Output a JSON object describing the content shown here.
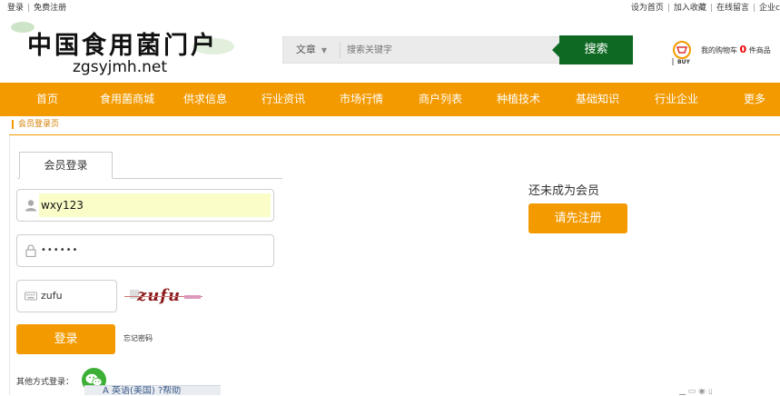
{
  "topbar": {
    "login": "登录",
    "register": "免费注册",
    "homepage": "设为首页",
    "favorite": "加入收藏",
    "message": "在线留言",
    "enterprise": "企业c"
  },
  "header": {
    "logo_cn": "中国食用菌门户",
    "logo_en": "zgsyjmh.net",
    "search_category": "文章",
    "search_placeholder": "搜索关键字",
    "search_button": "搜索",
    "cart_label_pre": "我的购物车",
    "cart_count": "0",
    "cart_label_post": "件商品",
    "cart_icon_text": "BUY"
  },
  "nav": [
    "首页",
    "食用菌商城",
    "供求信息",
    "行业资讯",
    "市场行情",
    "商户列表",
    "种植技术",
    "基础知识",
    "行业企业",
    "更多"
  ],
  "breadcrumb": "会员登录页",
  "login": {
    "tab": "会员登录",
    "username": "wxy123",
    "password": "••••••",
    "code": "zufu",
    "captcha": "zufu",
    "submit": "登录",
    "forgot": "忘记密码",
    "other": "其他方式登录："
  },
  "register": {
    "prompt": "还未成为会员",
    "button": "请先注册"
  },
  "floating": {
    "text": "A 英语(美国)  ?帮助"
  },
  "colors": {
    "accent": "#f39a00",
    "search_button": "#0e6a22",
    "wechat": "#3cb035"
  }
}
